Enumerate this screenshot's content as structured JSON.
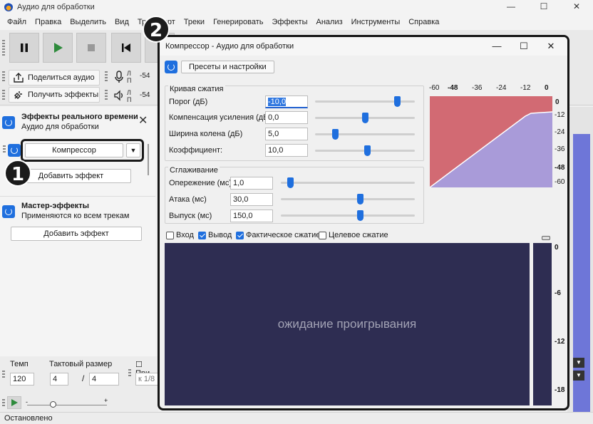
{
  "window": {
    "title": "Аудио для обработки",
    "controls": [
      "—",
      "☐",
      "✕"
    ]
  },
  "menu": [
    "Файл",
    "Правка",
    "Выделить",
    "Вид",
    "Транспорт",
    "Треки",
    "Генерировать",
    "Эффекты",
    "Анализ",
    "Инструменты",
    "Справка"
  ],
  "toolbar2": {
    "share": "Поделиться аудио",
    "get_effects": "Получить эффекты",
    "rec_l": "Л",
    "rec_r": "П",
    "rec_val": "-54",
    "play_l": "Л",
    "play_r": "П",
    "play_val": "-54"
  },
  "realtime": {
    "title": "Эффекты реального времени",
    "subtitle": "Аудио для обработки",
    "effect": "Компрессор",
    "add": "Добавить эффект"
  },
  "master": {
    "title": "Мастер-эффекты",
    "subtitle": "Применяются ко всем трекам",
    "add": "Добавить эффект"
  },
  "bottom": {
    "tempo_label": "Темп",
    "tempo_value": "120",
    "meter_label": "Тактовый размер",
    "meter_num": "4",
    "meter_sep": "/",
    "meter_den": "4",
    "snap_label": "При",
    "snap_value": "к 1/8"
  },
  "status": "Остановлено",
  "annotations": [
    "1",
    "2"
  ],
  "dialog": {
    "title": "Компрессор - Аудио для обработки",
    "presets": "Пресеты и настройки",
    "curve_group": "Кривая сжатия",
    "threshold_label": "Порог (дБ)",
    "threshold": "-10,0",
    "makeup_label": "Компенсация усиления (дБ)",
    "makeup": "0,0",
    "knee_label": "Ширина колена (дБ)",
    "knee": "5,0",
    "ratio_label": "Коэффициент:",
    "ratio": "10,0",
    "smooth_group": "Сглаживание",
    "lookahead_label": "Опережение (мс)",
    "lookahead": "1,0",
    "attack_label": "Атака (мс)",
    "attack": "30,0",
    "release_label": "Выпуск (мс)",
    "release": "150,0",
    "cb_input": "Вход",
    "cb_output": "Вывод",
    "cb_actual": "Фактическое сжатие",
    "cb_target": "Целевое сжатие",
    "waiting": "ожидание проигрывания",
    "graph_top_ticks": [
      "-60",
      "-48",
      "-36",
      "-24",
      "-12",
      "0"
    ],
    "graph_right_ticks": [
      "0",
      "-12",
      "-24",
      "-36",
      "-48",
      "-60"
    ],
    "meter_ticks": [
      "0",
      "-6",
      "-12",
      "-18"
    ],
    "sliders": {
      "threshold": 0.85,
      "makeup": 0.5,
      "knee": 0.18,
      "ratio": 0.53,
      "lookahead": 0.05,
      "attack": 0.6,
      "release": 0.6
    }
  },
  "colors": {
    "accent": "#1f6fde",
    "graph_compressed": "#a99bd9",
    "graph_uncompressed": "#d26a73",
    "wave_bg": "#2e2d52"
  }
}
